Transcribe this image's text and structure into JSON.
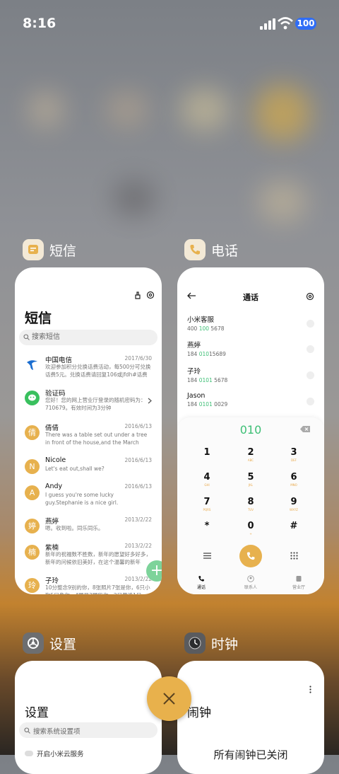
{
  "status": {
    "time": "8:16",
    "battery": "100"
  },
  "apps": {
    "sms": {
      "label": "短信",
      "title": "短信",
      "search_placeholder": "搜索短信",
      "messages": [
        {
          "avatar": "",
          "name": "中国电信",
          "date": "2017/6/30",
          "preview": "欢迎参加积分兑换话费活动，每500分可兑换话费5元。兑换话费请回复106或jfdh#话费"
        },
        {
          "avatar": "",
          "name": "验证码",
          "date": "",
          "preview": "您好！您的网上营业厅登录的随机密码为：710679。有效时间为3分钟"
        },
        {
          "avatar": "倩",
          "name": "倩倩",
          "date": "2016/6/13",
          "preview": "There was a table set out under a tree in front of the house,and the March Hare and..."
        },
        {
          "avatar": "N",
          "name": "Nicole",
          "date": "2016/6/13",
          "preview": "Let's eat out,shall we?"
        },
        {
          "avatar": "A",
          "name": "Andy",
          "date": "2016/6/13",
          "preview": "I guess you're some lucky guy.Stephanie is a nice girl."
        },
        {
          "avatar": "婷",
          "name": "燕婷",
          "date": "2013/2/22",
          "preview": "嗯。收到啦。同乐同乐。"
        },
        {
          "avatar": "楠",
          "name": "紫楠",
          "date": "2013/2/22",
          "preview": "新年的祝福数不胜数，新年的愿望好多好多，新年的问候依旧美好，在这个温馨的新年"
        },
        {
          "avatar": "玲",
          "name": "子玲",
          "date": "2013/2/22",
          "preview": "10分整念9别的你，8张照片7张是你，6只小狗5只像你，4颗星3颗段你，2只黄鸡1只"
        }
      ]
    },
    "phone": {
      "label": "电话",
      "title": "通话",
      "contacts": [
        {
          "name": "小米客服",
          "num_a": "400 ",
          "num_hl": "100",
          "num_b": " 5678"
        },
        {
          "name": "燕婷",
          "num_a": "184 ",
          "num_hl": "010",
          "num_b": "15689"
        },
        {
          "name": "子玲",
          "num_a": "184 ",
          "num_hl": "0101",
          "num_b": " 5678"
        },
        {
          "name": "Jason",
          "num_a": "184 ",
          "num_hl": "0101",
          "num_b": " 0029"
        }
      ],
      "dial_input": "010",
      "keys": [
        {
          "d": "1",
          "l": ""
        },
        {
          "d": "2",
          "l": "ABC"
        },
        {
          "d": "3",
          "l": "DEF"
        },
        {
          "d": "4",
          "l": "GHI"
        },
        {
          "d": "5",
          "l": "JKL"
        },
        {
          "d": "6",
          "l": "MNO"
        },
        {
          "d": "7",
          "l": "PQRS"
        },
        {
          "d": "8",
          "l": "TUV"
        },
        {
          "d": "9",
          "l": "WXYZ"
        },
        {
          "d": "*",
          "l": ""
        },
        {
          "d": "0",
          "l": "+"
        },
        {
          "d": "#",
          "l": ""
        }
      ],
      "tabs": [
        "通话",
        "联系人",
        "营业厅"
      ]
    },
    "settings": {
      "label": "设置",
      "title": "设置",
      "search_placeholder": "搜索系统设置项",
      "first_item": "开启小米云服务"
    },
    "clock": {
      "label": "时钟",
      "title": "闹钟",
      "empty_text": "所有闹钟已关闭"
    }
  },
  "colors": {
    "accent_green": "#3dbf75",
    "accent_orange": "#e8b14c"
  }
}
